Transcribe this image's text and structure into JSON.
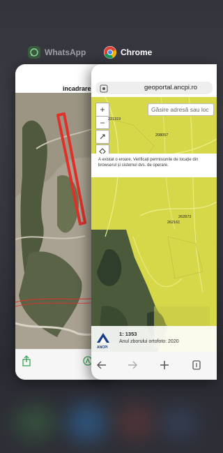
{
  "switcher": {
    "apps": [
      {
        "name": "WhatsApp",
        "color": "#9e9ea4",
        "icon": "whatsapp-icon"
      },
      {
        "name": "Chrome",
        "color": "#ffffff",
        "icon": "chrome-icon"
      }
    ]
  },
  "whatsapp": {
    "title": "incadrare"
  },
  "chrome": {
    "url": "geoportal.ancpi.ro",
    "search_placeholder": "Găsire adresă sau loc",
    "error_message": "A existat o eroare. Verificați permisiunile de locație din browserul și sistemul dvs. de operare.",
    "parcel_labels": [
      "221319",
      "208057",
      "262873",
      "262161"
    ],
    "scale": "1: 1353",
    "orthophoto_year": "Anul zborului ortofoto: 2020",
    "logo": "ANCPI",
    "zoom_in": "+",
    "zoom_out": "−"
  },
  "colors": {
    "map_overlay": "#d6d84a",
    "boundary_red": "#e0302a"
  }
}
